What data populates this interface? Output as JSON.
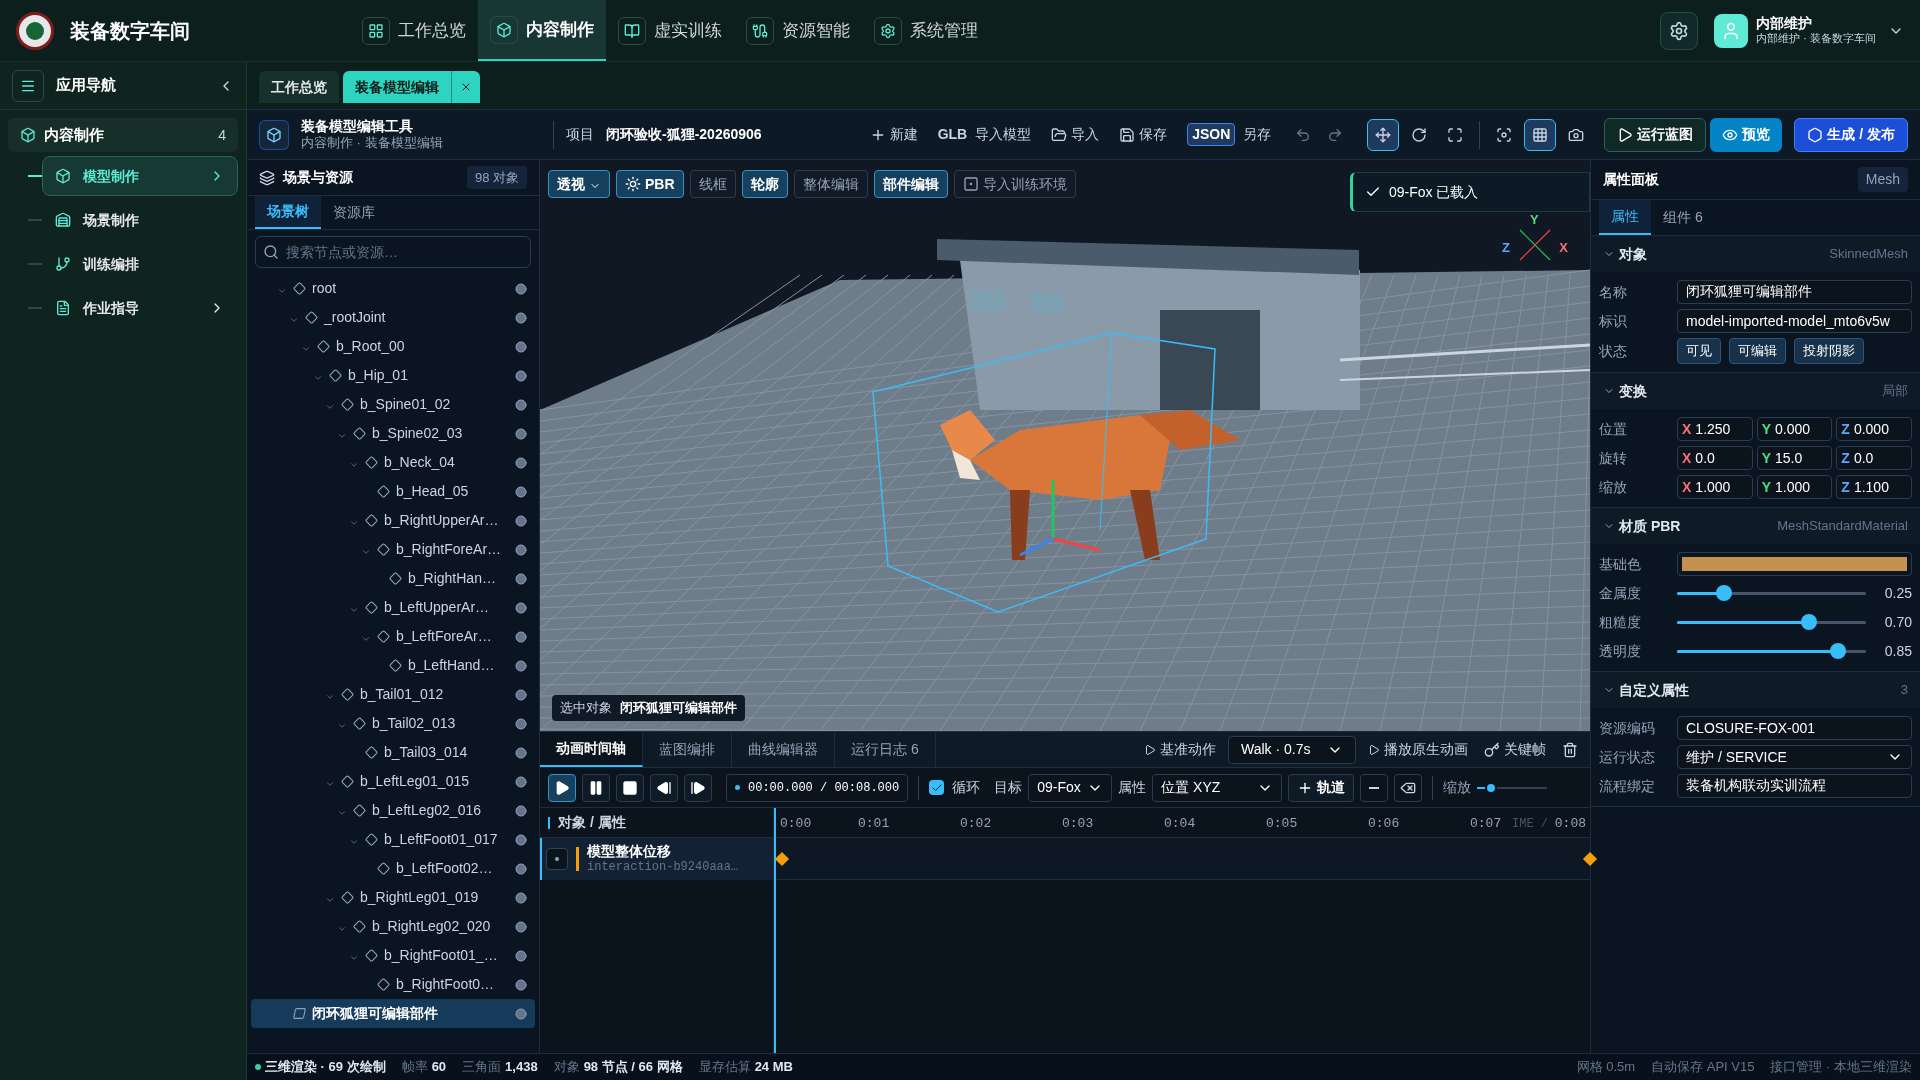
{
  "app": {
    "title": "装备数字车间"
  },
  "top_nav": [
    {
      "label": "工作总览",
      "selected": false
    },
    {
      "label": "内容制作",
      "selected": true
    },
    {
      "label": "虚实训练",
      "selected": false
    },
    {
      "label": "资源智能",
      "selected": false
    },
    {
      "label": "系统管理",
      "selected": false
    }
  ],
  "user": {
    "name": "内部维护",
    "subtitle": "内部维护 · 装备数字车间"
  },
  "sidebar": {
    "title": "应用导航",
    "section": {
      "label": "内容制作",
      "count": "4"
    },
    "items": [
      {
        "label": "模型制作",
        "selected": true,
        "has_submenu": true
      },
      {
        "label": "场景制作",
        "selected": false,
        "has_submenu": false
      },
      {
        "label": "训练编排",
        "selected": false,
        "has_submenu": false
      },
      {
        "label": "作业指导",
        "selected": false,
        "has_submenu": true
      }
    ]
  },
  "tabs": [
    {
      "label": "工作总览",
      "selected": false,
      "closable": false
    },
    {
      "label": "装备模型编辑",
      "selected": true,
      "closable": true
    }
  ],
  "tool": {
    "title": "装备模型编辑工具",
    "breadcrumb": "内容制作 · 装备模型编辑",
    "project_label": "项目",
    "project": "闭环验收-狐狸-20260906",
    "actions": [
      {
        "kind": "plus",
        "label": "新建"
      },
      {
        "kind": "tag",
        "tag": "GLB",
        "label": "导入模型"
      },
      {
        "kind": "folder",
        "label": "导入"
      },
      {
        "kind": "save",
        "label": "保存"
      },
      {
        "kind": "boxed",
        "tag": "JSON",
        "label": "另存"
      }
    ],
    "transform_tools": [
      {
        "selected": true
      },
      {
        "selected": false
      },
      {
        "selected": false
      }
    ],
    "view_tools": [
      {
        "selected": false
      },
      {
        "selected": true
      },
      {
        "selected": false
      }
    ],
    "buttons": [
      {
        "kind": "outline",
        "label": "运行蓝图"
      },
      {
        "kind": "accent",
        "label": "预览"
      },
      {
        "kind": "primary",
        "label": "生成 / 发布"
      }
    ]
  },
  "scene": {
    "title": "场景与资源",
    "count": "98 对象",
    "tabs": [
      {
        "label": "场景树",
        "selected": true
      },
      {
        "label": "资源库",
        "selected": false
      }
    ],
    "search_placeholder": "搜索节点或资源…",
    "tree": [
      {
        "label": "root",
        "kind": "bone",
        "selected": false,
        "children": [
          {
            "label": "_rootJoint",
            "kind": "bone",
            "selected": false,
            "children": [
              {
                "label": "b_Root_00",
                "kind": "bone",
                "selected": false,
                "children": [
                  {
                    "label": "b_Hip_01",
                    "kind": "bone",
                    "selected": false,
                    "children": [
                      {
                        "label": "b_Spine01_02",
                        "kind": "bone",
                        "selected": false,
                        "children": [
                          {
                            "label": "b_Spine02_03",
                            "kind": "bone",
                            "selected": false,
                            "children": [
                              {
                                "label": "b_Neck_04",
                                "kind": "bone",
                                "selected": false,
                                "children": [
                                  {
                                    "label": "b_Head_05",
                                    "kind": "bone",
                                    "selected": false
                                  }
                                ]
                              },
                              {
                                "label": "b_RightUpperAr…",
                                "kind": "bone",
                                "selected": false,
                                "children": [
                                  {
                                    "label": "b_RightForeAr…",
                                    "kind": "bone",
                                    "selected": false,
                                    "children": [
                                      {
                                        "label": "b_RightHan…",
                                        "kind": "bone",
                                        "selected": false
                                      }
                                    ]
                                  }
                                ]
                              },
                              {
                                "label": "b_LeftUpperAr…",
                                "kind": "bone",
                                "selected": false,
                                "children": [
                                  {
                                    "label": "b_LeftForeAr…",
                                    "kind": "bone",
                                    "selected": false,
                                    "children": [
                                      {
                                        "label": "b_LeftHand…",
                                        "kind": "bone",
                                        "selected": false
                                      }
                                    ]
                                  }
                                ]
                              }
                            ]
                          }
                        ]
                      },
                      {
                        "label": "b_Tail01_012",
                        "kind": "bone",
                        "selected": false,
                        "children": [
                          {
                            "label": "b_Tail02_013",
                            "kind": "bone",
                            "selected": false,
                            "children": [
                              {
                                "label": "b_Tail03_014",
                                "kind": "bone",
                                "selected": false
                              }
                            ]
                          }
                        ]
                      },
                      {
                        "label": "b_LeftLeg01_015",
                        "kind": "bone",
                        "selected": false,
                        "children": [
                          {
                            "label": "b_LeftLeg02_016",
                            "kind": "bone",
                            "selected": false,
                            "children": [
                              {
                                "label": "b_LeftFoot01_017",
                                "kind": "bone",
                                "selected": false,
                                "children": [
                                  {
                                    "label": "b_LeftFoot02…",
                                    "kind": "bone",
                                    "selected": false
                                  }
                                ]
                              }
                            ]
                          }
                        ]
                      },
                      {
                        "label": "b_RightLeg01_019",
                        "kind": "bone",
                        "selected": false,
                        "children": [
                          {
                            "label": "b_RightLeg02_020",
                            "kind": "bone",
                            "selected": false,
                            "children": [
                              {
                                "label": "b_RightFoot01_…",
                                "kind": "bone",
                                "selected": false,
                                "children": [
                                  {
                                    "label": "b_RightFoot0…",
                                    "kind": "bone",
                                    "selected": false
                                  }
                                ]
                              }
                            ]
                          }
                        ]
                      }
                    ]
                  }
                ]
              }
            ]
          }
        ]
      },
      {
        "label": "闭环狐狸可编辑部件",
        "kind": "mesh",
        "selected": true
      }
    ]
  },
  "viewport": {
    "toolbar": [
      {
        "label": "透视",
        "active": true
      },
      {
        "label": "PBR",
        "active": true
      },
      {
        "label": "线框",
        "active": false
      },
      {
        "label": "轮廓",
        "active": true
      },
      {
        "label": "整体编辑",
        "active": false
      },
      {
        "label": "部件编辑",
        "active": true
      },
      {
        "label": "导入训练环境",
        "active": false
      }
    ],
    "toast": "09-Fox 已载入",
    "axes": {
      "y": "Y",
      "z": "Z",
      "x": "X"
    },
    "selection": {
      "label": "选中对象",
      "value": "闭环狐狸可编辑部件"
    }
  },
  "timeline": {
    "tabs": [
      {
        "label": "动画时间轴",
        "selected": true
      },
      {
        "label": "蓝图编排",
        "selected": false
      },
      {
        "label": "曲线编辑器",
        "selected": false
      },
      {
        "label": "运行日志 6",
        "selected": false
      }
    ],
    "base_action": "基准动作",
    "animation": "Walk · 0.7s",
    "play_native": "播放原生动画",
    "keyframe": "关键帧",
    "playback": [
      {
        "selected": true
      },
      {
        "selected": false
      },
      {
        "selected": false
      },
      {
        "selected": false
      },
      {
        "selected": false
      }
    ],
    "time": "00:00.000 / 00:08.000",
    "loop": {
      "label": "循环",
      "checked": true
    },
    "target": {
      "label": "目标",
      "value": "09-Fox"
    },
    "property": {
      "label": "属性",
      "value": "位置 XYZ"
    },
    "add_track": "轨道",
    "zoom": {
      "label": "缩放",
      "level": 0.2
    },
    "header": "对象 / 属性",
    "ticks": [
      "0:00",
      "0:01",
      "0:02",
      "0:03",
      "0:04",
      "0:05",
      "0:06",
      "0:07",
      "0:08"
    ],
    "time_hint": "IME /",
    "tracks": [
      {
        "name": "模型整体位移",
        "id": "interaction-b9240aaa…"
      }
    ]
  },
  "properties": {
    "title": "属性面板",
    "badge": "Mesh",
    "tabs": [
      {
        "label": "属性",
        "selected": true
      },
      {
        "label": "组件 6",
        "selected": false
      }
    ],
    "object": {
      "title": "对象",
      "type": "SkinnedMesh",
      "fields": [
        {
          "label": "名称",
          "value": "闭环狐狸可编辑部件"
        },
        {
          "label": "标识",
          "value": "model-imported-model_mto6v5w"
        }
      ],
      "state_label": "状态",
      "states": [
        {
          "label": "可见",
          "on": true
        },
        {
          "label": "可编辑",
          "on": true
        },
        {
          "label": "投射阴影",
          "on": true
        }
      ]
    },
    "transform": {
      "title": "变换",
      "space": "局部",
      "rows": [
        {
          "label": "位置",
          "values": [
            {
              "axis": "X",
              "value": "1.250"
            },
            {
              "axis": "Y",
              "value": "0.000"
            },
            {
              "axis": "Z",
              "value": "0.000"
            }
          ]
        },
        {
          "label": "旋转",
          "values": [
            {
              "axis": "X",
              "value": "0.0"
            },
            {
              "axis": "Y",
              "value": "15.0"
            },
            {
              "axis": "Z",
              "value": "0.0"
            }
          ]
        },
        {
          "label": "缩放",
          "values": [
            {
              "axis": "X",
              "value": "1.000"
            },
            {
              "axis": "Y",
              "value": "1.000"
            },
            {
              "axis": "Z",
              "value": "1.100"
            }
          ]
        }
      ]
    },
    "material": {
      "title": "材质 PBR",
      "type": "MeshStandardMaterial",
      "color_label": "基础色",
      "color": "#c4914f",
      "sliders": [
        {
          "label": "金属度",
          "level": 0.25,
          "reading": "0.25"
        },
        {
          "label": "粗糙度",
          "level": 0.7,
          "reading": "0.70"
        },
        {
          "label": "透明度",
          "level": 0.85,
          "reading": "0.85"
        }
      ]
    },
    "custom": {
      "title": "自定义属性",
      "count": "3",
      "fields": [
        {
          "kind": "text",
          "label": "资源编码",
          "value": "CLOSURE-FOX-001"
        },
        {
          "kind": "select",
          "label": "运行状态",
          "value": "维护 / SERVICE"
        },
        {
          "kind": "text",
          "label": "流程绑定",
          "value": "装备机构联动实训流程"
        }
      ]
    }
  },
  "status_bar": {
    "render": "三维渲染 · 69 次绘制",
    "stats": [
      {
        "label": "帧率",
        "value": "60"
      },
      {
        "label": "三角面",
        "value": "1,438"
      },
      {
        "label": "对象",
        "value": "98 节点 / 66 网格"
      },
      {
        "label": "显存估算",
        "value": "24 MB"
      }
    ],
    "right": [
      "网格 0.5m",
      "自动保存 API V15",
      "接口管理 · 本地三维渲染"
    ]
  }
}
